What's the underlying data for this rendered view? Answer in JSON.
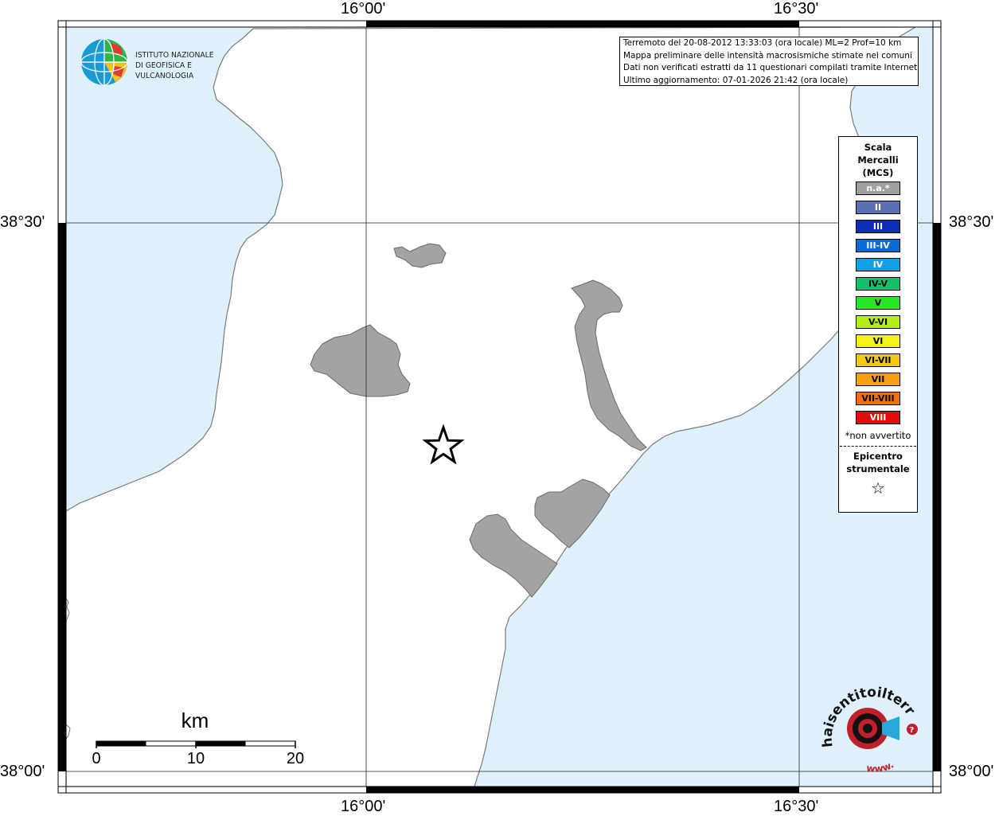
{
  "map": {
    "title_lines": [
      "Terremoto del 20-08-2012 13:33:03 (ora locale) ML=2 Prof=10 km",
      "Mappa preliminare delle intensità macrosismiche stimate nei comuni",
      "Dati non verificati estratti da 11 questionari compilati tramite Internet.",
      "Ultimo aggiornamento: 07-01-2026 21:42 (ora locale)"
    ],
    "lon_labels": [
      "16°00'",
      "16°30'"
    ],
    "lat_labels": [
      "38°30'",
      "38°00'"
    ],
    "colors": {
      "sea": "#dff1fc",
      "land": "#ffffff",
      "municipality": "#a3a3a3",
      "coast": "#7a7a7a"
    }
  },
  "legend": {
    "title_lines": [
      "Scala",
      "Mercalli",
      "(MCS)"
    ],
    "items": [
      {
        "label": "n.a.*",
        "color": "#a0a0a0",
        "text_color": "#ffffff"
      },
      {
        "label": "II",
        "color": "#5a6fb4",
        "text_color": "#ffffff"
      },
      {
        "label": "III",
        "color": "#0a2fb4",
        "text_color": "#ffffff"
      },
      {
        "label": "III-IV",
        "color": "#0a6ad2",
        "text_color": "#ffffff"
      },
      {
        "label": "IV",
        "color": "#14a0e6",
        "text_color": "#ffffff"
      },
      {
        "label": "IV-V",
        "color": "#14c06a",
        "text_color": "#000000"
      },
      {
        "label": "V",
        "color": "#28e628",
        "text_color": "#000000"
      },
      {
        "label": "V-VI",
        "color": "#b4f014",
        "text_color": "#000000"
      },
      {
        "label": "VI",
        "color": "#f5f514",
        "text_color": "#000000"
      },
      {
        "label": "VI-VII",
        "color": "#f5c814",
        "text_color": "#000000"
      },
      {
        "label": "VII",
        "color": "#f5a014",
        "text_color": "#000000"
      },
      {
        "label": "VII-VIII",
        "color": "#f56e14",
        "text_color": "#000000"
      },
      {
        "label": "VIII",
        "color": "#e60a0a",
        "text_color": "#ffffff"
      }
    ],
    "note": "*non avvertito",
    "epicenter_lines": [
      "Epicentro",
      "strumentale"
    ],
    "epicenter_symbol": "☆"
  },
  "scale": {
    "unit": "km",
    "labels": [
      "0",
      "10",
      "20"
    ]
  },
  "logos": {
    "ingv_lines": [
      "ISTITUTO NAZIONALE",
      "DI GEOFISICA E VULCANOLOGIA"
    ],
    "hsit_text": "haisentitoilterremoto.it",
    "hsit_prefix": "www."
  }
}
